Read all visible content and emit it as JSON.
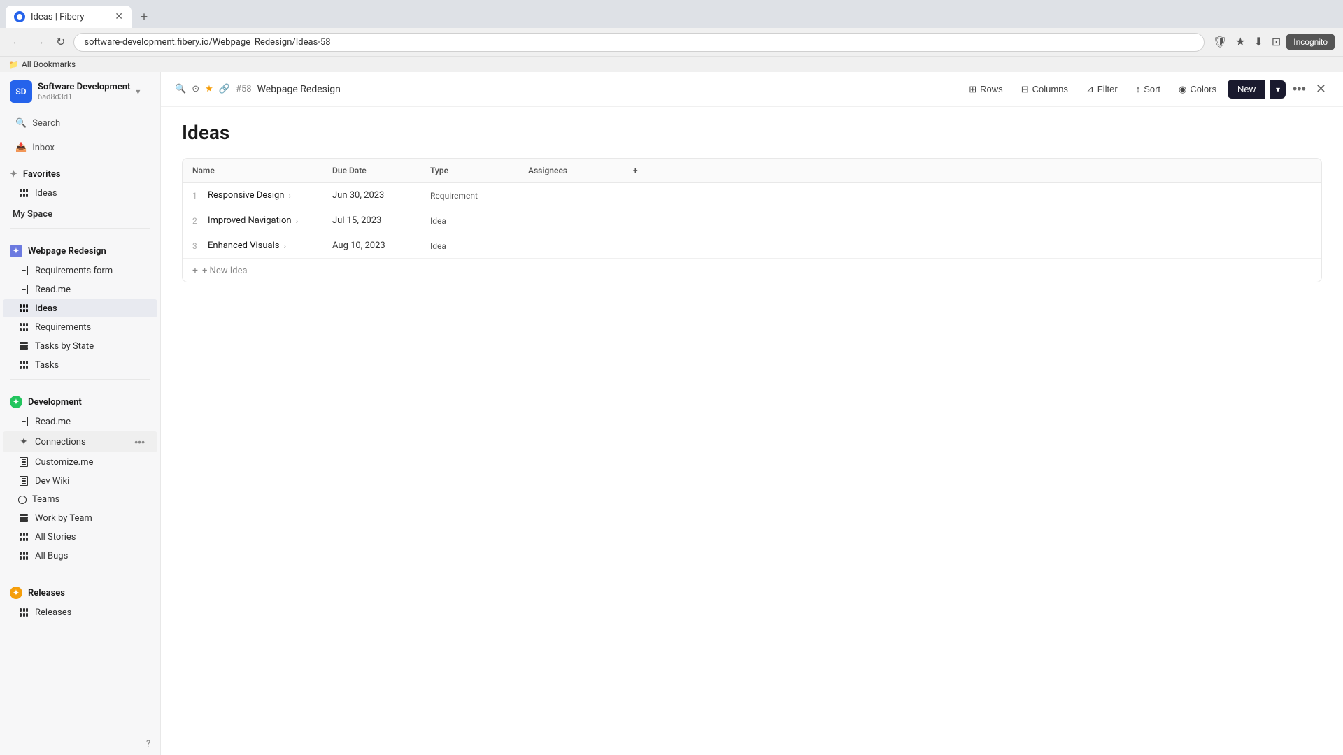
{
  "browser": {
    "tab_title": "Ideas | Fibery",
    "tab_url": "software-development.fibery.io/Webpage_Redesign/Ideas-58",
    "new_tab_label": "+",
    "nav_back": "←",
    "nav_forward": "→",
    "nav_refresh": "↻",
    "incognito_label": "Incognito",
    "bookmarks_label": "All Bookmarks"
  },
  "workspace": {
    "name": "Software Development",
    "id": "6ad8d3d1",
    "avatar_text": "SD"
  },
  "sidebar": {
    "search_label": "Search",
    "inbox_label": "Inbox",
    "favorites_label": "Favorites",
    "favorites_items": [
      {
        "label": "Ideas",
        "icon": "grid"
      }
    ],
    "my_space_label": "My Space",
    "webpage_redesign_label": "Webpage Redesign",
    "webpage_items": [
      {
        "label": "Requirements form",
        "icon": "doc"
      },
      {
        "label": "Read.me",
        "icon": "doc"
      },
      {
        "label": "Ideas",
        "icon": "grid",
        "active": true
      },
      {
        "label": "Requirements",
        "icon": "grid"
      },
      {
        "label": "Tasks by State",
        "icon": "bars"
      },
      {
        "label": "Tasks",
        "icon": "grid"
      }
    ],
    "development_label": "Development",
    "development_items": [
      {
        "label": "Read.me",
        "icon": "doc"
      },
      {
        "label": "Connections",
        "icon": "plus-grid",
        "hovered": true
      },
      {
        "label": "Customize.me",
        "icon": "doc"
      },
      {
        "label": "Dev Wiki",
        "icon": "doc"
      },
      {
        "label": "Teams",
        "icon": "circle"
      },
      {
        "label": "Work by Team",
        "icon": "bars"
      },
      {
        "label": "All Stories",
        "icon": "grid"
      },
      {
        "label": "All Bugs",
        "icon": "grid"
      }
    ],
    "releases_label": "Releases",
    "releases_items": [
      {
        "label": "Releases",
        "icon": "grid"
      }
    ]
  },
  "topbar": {
    "item_number": "#58",
    "breadcrumb": "Webpage Redesign",
    "rows_label": "Rows",
    "columns_label": "Columns",
    "filter_label": "Filter",
    "sort_label": "Sort",
    "colors_label": "Colors",
    "new_label": "New",
    "more_icon": "•••",
    "close_icon": "✕"
  },
  "content": {
    "page_title": "Ideas",
    "table": {
      "columns": [
        "Name",
        "Due Date",
        "Type",
        "Assignees",
        "+"
      ],
      "rows": [
        {
          "num": "1",
          "name": "Responsive Design",
          "due_date": "Jun 30, 2023",
          "type": "Requirement"
        },
        {
          "num": "2",
          "name": "Improved Navigation",
          "due_date": "Jul 15, 2023",
          "type": "Idea"
        },
        {
          "num": "3",
          "name": "Enhanced Visuals",
          "due_date": "Aug 10, 2023",
          "type": "Idea"
        }
      ],
      "add_new_label": "+ New Idea"
    }
  }
}
